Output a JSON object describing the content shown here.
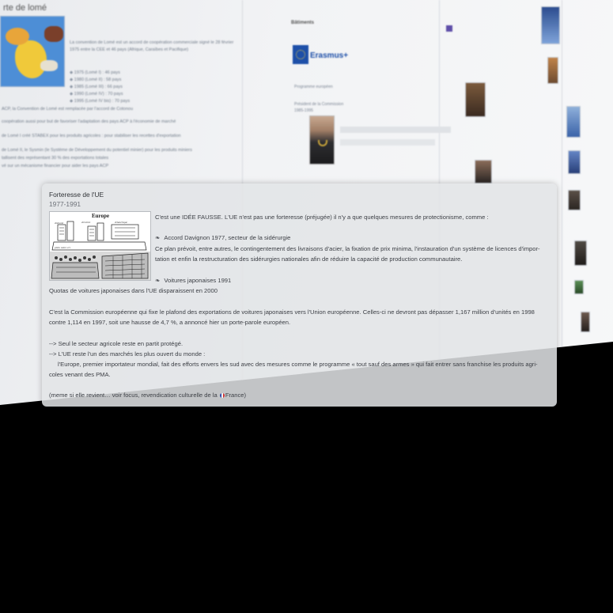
{
  "background": {
    "left_column": {
      "title": "rte de lomé",
      "list": [
        "1975 (Lomé I) : 46 pays",
        "1980 (Lomé II) : 58 pays",
        "1985 (Lomé III) : 66 pays",
        "1990 (Lomé IV) : 70 pays",
        "1995 (Lomé IV bis) : 70 pays"
      ],
      "para1": "La convention de Lomé est un accord de coopération commerciale signé le 28 février 1975 entre la CEE et 46 pays (Afrique, Caraïbes et Pacifique)",
      "para2": "ACP, la Convention de Lomé est remplacée par l'accord de Cotonou",
      "para3": "coopération aussi pour but de favoriser l'adaptation des pays ACP à l'économie de marché",
      "para4": "de Lomé I créé STABEX pour les produits agricoles : pour stabiliser les recettes d'exportation",
      "para5": "de Lomé II, le Sysmin (le Système de Développement du potentiel minier) pour les produits miniers",
      "para6": "tallisent des représentant 30 % des exportations totales",
      "para7": "vé sur un mécanisme financier pour aider les pays ACP"
    },
    "middle_column": {
      "heading": "Bâtiments",
      "erasmus_label": "Erasmus+",
      "small1": "Programme européen",
      "small2": "Président de la Commission",
      "small3": "1985-1995"
    }
  },
  "note": {
    "title": "Forteresse de l'UE",
    "dates": "1977-1991",
    "cartoon": {
      "caption_title": "Europe",
      "caption_left": "d'abord",
      "caption_mid": "d'entrée",
      "caption_right": "d'Amérique",
      "caption_bottom": "plein notre cri"
    },
    "intro": "C'est une IDÉE FAUSSE. L'UE n'est pas une forteresse (préjugée) il n'y a que quelques mesures de protectionisme, comme :",
    "item1_glyph": "❧",
    "item1_title": "Accord Davignon 1977, secteur de la sidérurgie",
    "item1_body_line1": "Ce plan prévoit, entre autres, le contingentement des livraisons d'acier, la fixation de prix minima, l'instauration d'un système de licences d'impor-",
    "item1_body_line2": "tation et enfin la restructuration des sidérurgies nationales afin de réduire la capacité de production communautaire.",
    "item2_glyph": "❧",
    "item2_title": "Voitures japonaises 1991",
    "item2_body": "Quotas de voitures japonaises dans l'UE disparaissent en 2000",
    "quote_line1": "C'est la Commission européenne qui fixe le plafond des exportations de voitures japonaises vers l'Union européenne. Celles-ci ne devront pas dépasser 1,167 million d'unités en 1998",
    "quote_line2": "contre 1,114 en 1997, soit une hausse de 4,7 %, a annoncé hier un porte-parole européen.",
    "arrow1": "--> Seul le secteur agricole reste en partit protégé.",
    "arrow2": "--> L'UE reste l'un des marchés les plus ouvert du monde :",
    "europe_line1": "l'Europe, premier importateur mondial, fait des efforts envers les sud   avec des mesures comme le programme « tout sauf des armes » qui   fait entrer sans franchise les produits agri-",
    "europe_line2": "coles venant des PMA.",
    "footer_before": "(meme si elle revient… voir focus, revendication culturelle de la ",
    "footer_country": "France)"
  },
  "colors": {
    "panel_bg": "#e2e4e7",
    "text": "#3c3f45",
    "eu_blue": "#1d4fa8",
    "backdrop": "#000000"
  }
}
